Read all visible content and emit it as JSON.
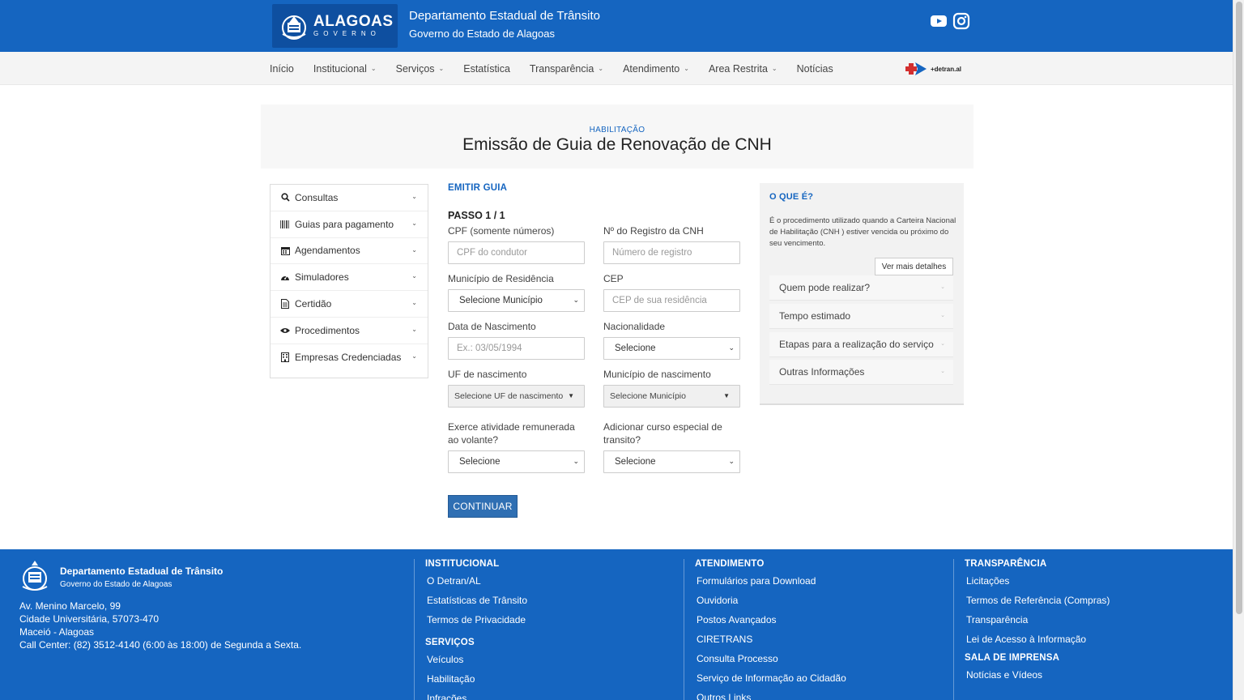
{
  "header": {
    "logo_text": "ALAGOAS",
    "logo_sub": "GOVERNO",
    "title": "Departamento Estadual de Trânsito",
    "subtitle": "Governo do Estado de Alagoas"
  },
  "nav": {
    "items": [
      {
        "label": "Início",
        "dropdown": false
      },
      {
        "label": "Institucional",
        "dropdown": true
      },
      {
        "label": "Serviços",
        "dropdown": true
      },
      {
        "label": "Estatística",
        "dropdown": false
      },
      {
        "label": "Transparência",
        "dropdown": true
      },
      {
        "label": "Atendimento",
        "dropdown": true
      },
      {
        "label": "Area Restrita",
        "dropdown": true
      },
      {
        "label": "Notícias",
        "dropdown": false
      }
    ],
    "brand": "+detran.al"
  },
  "banner": {
    "category": "HABILITAÇÃO",
    "title": "Emissão de Guia de Renovação de CNH"
  },
  "sidebar": {
    "items": [
      {
        "label": "Consultas",
        "icon": "search-icon"
      },
      {
        "label": "Guias para pagamento",
        "icon": "barcode-icon"
      },
      {
        "label": "Agendamentos",
        "icon": "calendar-icon"
      },
      {
        "label": "Simuladores",
        "icon": "dashboard-icon"
      },
      {
        "label": "Certidão",
        "icon": "document-icon"
      },
      {
        "label": "Procedimentos",
        "icon": "eye-icon"
      },
      {
        "label": "Empresas Credenciadas",
        "icon": "building-icon"
      }
    ]
  },
  "form": {
    "section": "EMITIR GUIA",
    "step": "PASSO 1 / 1",
    "fields": {
      "cpf": {
        "label": "CPF (somente números)",
        "placeholder": "CPF do condutor"
      },
      "registro": {
        "label": "Nº do Registro da CNH",
        "placeholder": "Número de registro"
      },
      "municipio_res": {
        "label": "Município de Residência",
        "value": "Selecione Município"
      },
      "cep": {
        "label": "CEP",
        "placeholder": "CEP de sua residência"
      },
      "nascimento": {
        "label": "Data de Nascimento",
        "placeholder": "Ex.: 03/05/1994"
      },
      "nacionalidade": {
        "label": "Nacionalidade",
        "value": "Selecione"
      },
      "uf_nasc": {
        "label": "UF de nascimento",
        "value": "Selecione UF de nascimento"
      },
      "municipio_nasc": {
        "label": "Município de nascimento",
        "value": "Selecione Município"
      },
      "atividade": {
        "label": "Exerce atividade remunerada ao volante?",
        "value": "Selecione"
      },
      "curso": {
        "label": "Adicionar curso especial de transito?",
        "value": "Selecione"
      }
    },
    "submit": "CONTINUAR"
  },
  "info": {
    "heading": "O QUE É?",
    "description": "É o procedimento utilizado quando a Carteira Nacional de Habilitação (CNH ) estiver vencida ou próximo do seu vencimento.",
    "more_button": "Ver mais detalhes",
    "accordion": [
      "Quem pode realizar?",
      "Tempo estimado",
      "Etapas para a realização do serviço",
      "Outras Informações"
    ]
  },
  "footer": {
    "org": "Departamento Estadual de Trânsito",
    "org_sub": "Governo do Estado de Alagoas",
    "address": [
      "Av. Menino Marcelo, 99",
      "Cidade Universitária, 57073-470",
      "Maceió - Alagoas",
      "Call Center: (82) 3512-4140 (6:00 às 18:00) de Segunda a Sexta."
    ],
    "institucional": {
      "heading": "INSTITUCIONAL",
      "links": [
        "O Detran/AL",
        "Estatísticas de Trânsito",
        "Termos de Privacidade"
      ]
    },
    "servicos": {
      "heading": "SERVIÇOS",
      "links": [
        "Veículos",
        "Habilitação",
        "Infrações"
      ]
    },
    "atendimento": {
      "heading": "ATENDIMENTO",
      "links": [
        "Formulários para Download",
        "Ouvidoria",
        "Postos Avançados",
        "CIRETRANS",
        "Consulta Processo",
        "Serviço de Informação ao Cidadão",
        "Outros Links"
      ]
    },
    "transparencia": {
      "heading": "TRANSPARÊNCIA",
      "links": [
        "Licitações",
        "Termos de Referência (Compras)",
        "Transparência",
        "Lei de Acesso à Informação"
      ]
    },
    "imprensa": {
      "heading": "SALA DE IMPRENSA",
      "links": [
        "Notícias e Vídeos"
      ]
    }
  },
  "colors": {
    "primary": "#1565c0",
    "button": "#2f6fb3",
    "nav_bg": "#f4f4f4"
  }
}
